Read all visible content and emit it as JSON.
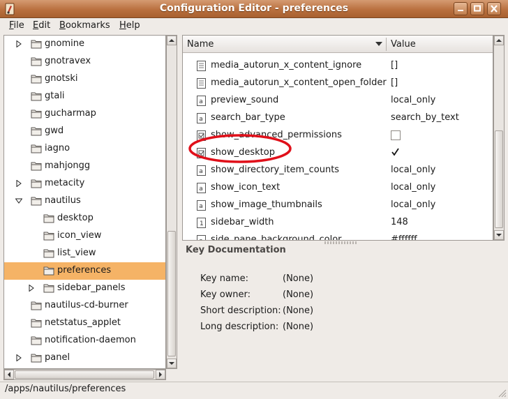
{
  "window": {
    "title": "Configuration Editor - preferences",
    "icon": "gconf-editor-icon"
  },
  "menu": {
    "file": {
      "underline": "F",
      "rest": "ile"
    },
    "edit": {
      "underline": "E",
      "rest": "dit"
    },
    "bookmarks": {
      "underline": "B",
      "rest": "ookmarks"
    },
    "help": {
      "underline": "H",
      "rest": "elp"
    }
  },
  "tree": {
    "items": [
      {
        "label": "gnomine",
        "expander": "collapsed"
      },
      {
        "label": "gnotravex",
        "expander": "none"
      },
      {
        "label": "gnotski",
        "expander": "none"
      },
      {
        "label": "gtali",
        "expander": "none"
      },
      {
        "label": "gucharmap",
        "expander": "none"
      },
      {
        "label": "gwd",
        "expander": "none"
      },
      {
        "label": "iagno",
        "expander": "none"
      },
      {
        "label": "mahjongg",
        "expander": "none"
      },
      {
        "label": "metacity",
        "expander": "collapsed"
      },
      {
        "label": "nautilus",
        "expander": "expanded"
      },
      {
        "label": "desktop",
        "expander": "none"
      },
      {
        "label": "icon_view",
        "expander": "none"
      },
      {
        "label": "list_view",
        "expander": "none"
      },
      {
        "label": "preferences",
        "expander": "none"
      },
      {
        "label": "sidebar_panels",
        "expander": "collapsed"
      },
      {
        "label": "nautilus-cd-burner",
        "expander": "none"
      },
      {
        "label": "netstatus_applet",
        "expander": "none"
      },
      {
        "label": "notification-daemon",
        "expander": "none"
      },
      {
        "label": "panel",
        "expander": "collapsed"
      }
    ]
  },
  "list": {
    "columns": {
      "name": "Name",
      "value": "Value"
    },
    "rows": [
      {
        "name": "media_autorun_x_content_ignore",
        "type": "list",
        "value": "[]"
      },
      {
        "name": "media_autorun_x_content_open_folder",
        "type": "list",
        "value": "[]"
      },
      {
        "name": "preview_sound",
        "type": "string",
        "value": "local_only"
      },
      {
        "name": "search_bar_type",
        "type": "string",
        "value": "search_by_text"
      },
      {
        "name": "show_advanced_permissions",
        "type": "bool",
        "value": "",
        "checked": false
      },
      {
        "name": "show_desktop",
        "type": "bool",
        "value": "",
        "checked": true
      },
      {
        "name": "show_directory_item_counts",
        "type": "string",
        "value": "local_only"
      },
      {
        "name": "show_icon_text",
        "type": "string",
        "value": "local_only"
      },
      {
        "name": "show_image_thumbnails",
        "type": "string",
        "value": "local_only"
      },
      {
        "name": "sidebar_width",
        "type": "int",
        "value": "148"
      },
      {
        "name": "side_pane_background_color",
        "type": "string",
        "value": "#ffffff"
      }
    ]
  },
  "docs": {
    "title": "Key Documentation",
    "fields": [
      {
        "label": "Key name:",
        "value": "(None)"
      },
      {
        "label": "Key owner:",
        "value": "(None)"
      },
      {
        "label": "Short description:",
        "value": "(None)"
      },
      {
        "label": "Long description:",
        "value": "(None)"
      }
    ]
  },
  "status": {
    "path": "/apps/nautilus/preferences"
  },
  "colors": {
    "selection": "#f5b366",
    "titlebar": "#b9703f",
    "annotation": "#e0101a"
  }
}
